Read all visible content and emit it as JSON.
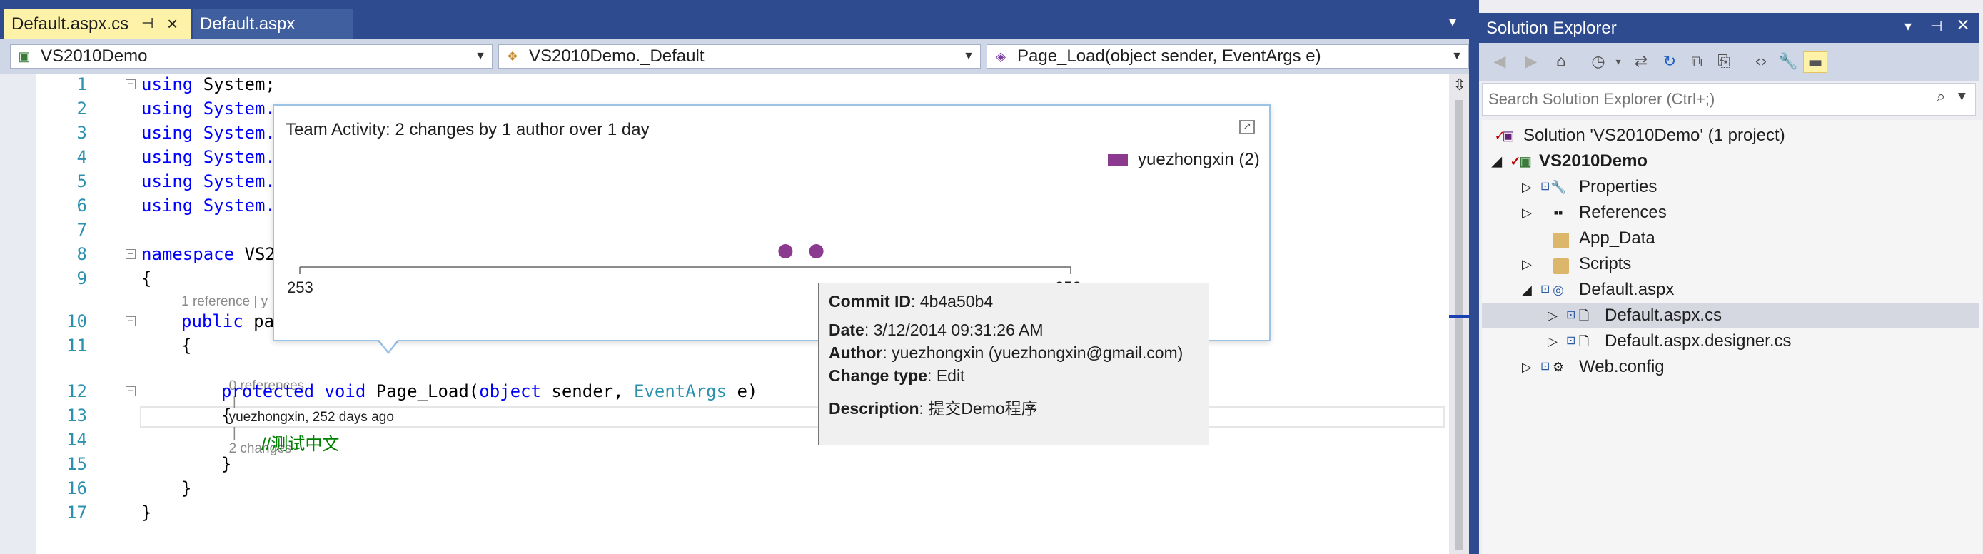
{
  "tabs": [
    {
      "label": "Default.aspx.cs",
      "active": true
    },
    {
      "label": "Default.aspx",
      "active": false
    }
  ],
  "nav": {
    "project": "VS2010Demo",
    "class": "VS2010Demo._Default",
    "member": "Page_Load(object sender, EventArgs e)"
  },
  "code": {
    "line_numbers": [
      "1",
      "2",
      "3",
      "4",
      "5",
      "6",
      "7",
      "8",
      "9",
      "10",
      "11",
      "12",
      "13",
      "14",
      "15",
      "16",
      "17"
    ],
    "lines": {
      "l1_kw": "using",
      "l1_rest": " System;",
      "l2": "using System.",
      "l3": "using System.",
      "l4": "using System.",
      "l5": "using System.",
      "l6": "using System.",
      "l8_kw": "namespace",
      "l8_rest": " VS2",
      "l9": "{",
      "l10_kw": "public",
      "l10_rest": " pa",
      "l11": "{",
      "l12_kw1": "protected",
      "l12_kw2": "void",
      "l12_mid": " Page_Load(",
      "l12_kw3": "object",
      "l12_mid2": " sender, ",
      "l12_type": "EventArgs",
      "l12_end": " e)",
      "l13": "{",
      "l14": "//测试中文",
      "l15": "}",
      "l16": "}",
      "l17": "}"
    },
    "codelens_class": "1 reference | y",
    "codelens_method": {
      "references": "0 references",
      "author": "yuezhongxin, 252 days ago",
      "changes": "2 changes"
    }
  },
  "team_popup": {
    "title": "Team Activity: 2 changes by 1 author over 1 day",
    "legend": "yuezhongxin (2)"
  },
  "chart_data": {
    "type": "scatter",
    "title": "Team Activity: 2 changes by 1 author over 1 day",
    "xlabel": "",
    "ylabel": "",
    "tick_labels": [
      "253",
      "252"
    ],
    "series": [
      {
        "name": "yuezhongxin (2)",
        "x": [
          252.37,
          252.33
        ],
        "y": [
          1,
          1
        ]
      }
    ],
    "xlim": [
      253,
      252
    ],
    "colors": {
      "series": "#8b3a8f"
    }
  },
  "commit": {
    "id_label": "Commit ID",
    "id": "4b4a50b4",
    "date_label": "Date",
    "date": "3/12/2014 09:31:26 AM",
    "author_label": "Author",
    "author": "yuezhongxin (yuezhongxin@gmail.com)",
    "change_type_label": "Change type",
    "change_type": "Edit",
    "description_label": "Description",
    "description": "提交Demo程序"
  },
  "solution_explorer": {
    "title": "Solution Explorer",
    "search_placeholder": "Search Solution Explorer (Ctrl+;)",
    "items": [
      {
        "label": "Solution 'VS2010Demo' (1 project)"
      },
      {
        "label": "VS2010Demo"
      },
      {
        "label": "Properties"
      },
      {
        "label": "References"
      },
      {
        "label": "App_Data"
      },
      {
        "label": "Scripts"
      },
      {
        "label": "Default.aspx"
      },
      {
        "label": "Default.aspx.cs"
      },
      {
        "label": "Default.aspx.designer.cs"
      },
      {
        "label": "Web.config"
      }
    ]
  },
  "colors": {
    "accent": "#2f4b8f",
    "active_tab": "#fdf2a8",
    "keyword": "#0000ff",
    "type": "#2b91af",
    "comment": "#008000"
  }
}
